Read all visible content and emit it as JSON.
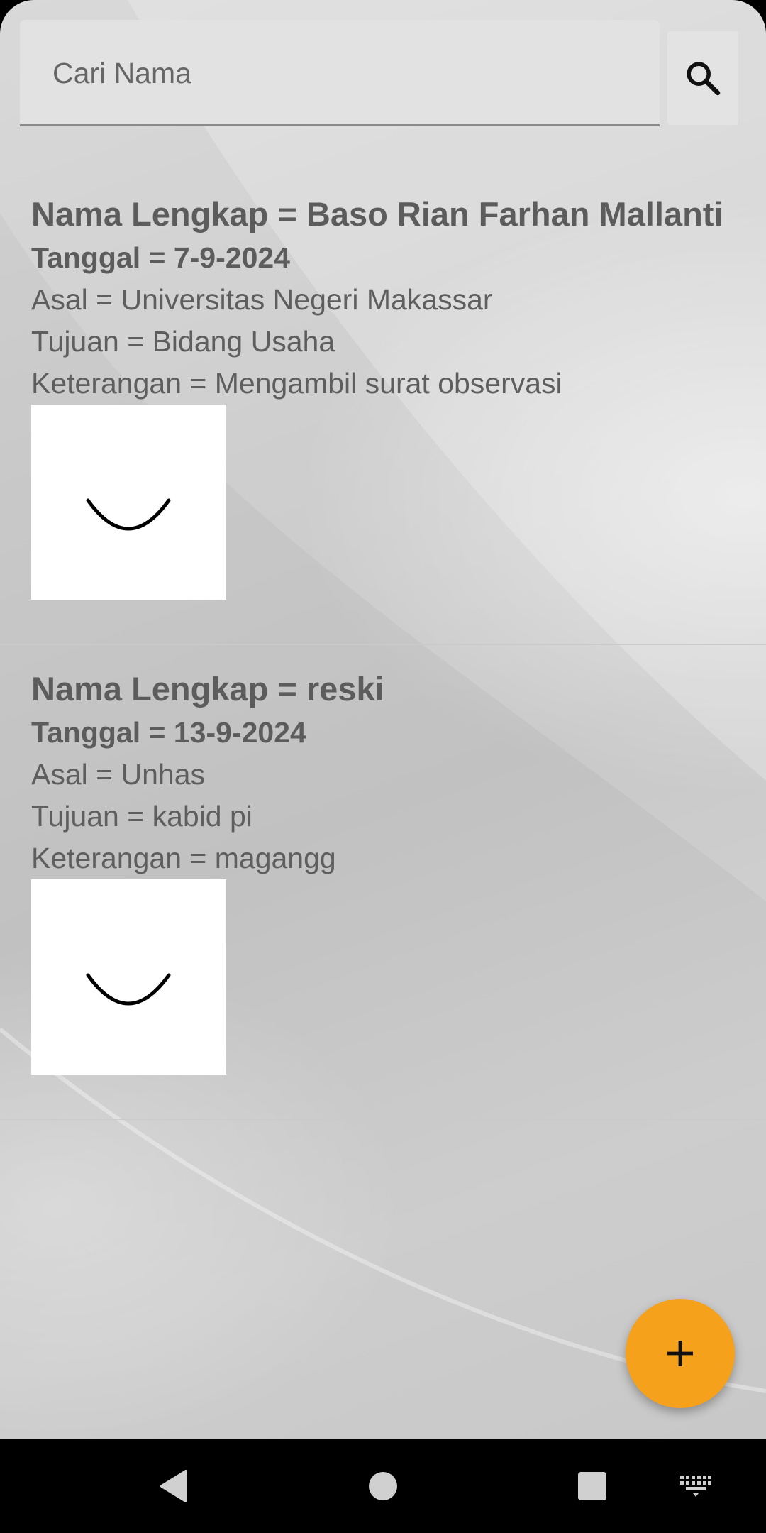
{
  "search": {
    "placeholder": "Cari Nama",
    "value": "",
    "icon": "search-icon"
  },
  "entries": [
    {
      "name": "Nama Lengkap = Baso Rian Farhan Mallanti",
      "date": "Tanggal = 7-9-2024",
      "origin": "Asal = Universitas Negeri Makassar",
      "purpose": "Tujuan = Bidang Usaha",
      "note": "Keterangan = Mengambil surat observasi",
      "signature": "signature-image"
    },
    {
      "name": "Nama Lengkap = reski",
      "date": "Tanggal = 13-9-2024",
      "origin": "Asal = Unhas",
      "purpose": "Tujuan = kabid pi",
      "note": "Keterangan = magangg",
      "signature": "signature-image"
    }
  ],
  "fab": {
    "icon": "plus-icon",
    "color": "#f5a11c"
  },
  "navbar": {
    "items": [
      "back-icon",
      "home-icon",
      "recents-icon",
      "keyboard-icon"
    ]
  }
}
